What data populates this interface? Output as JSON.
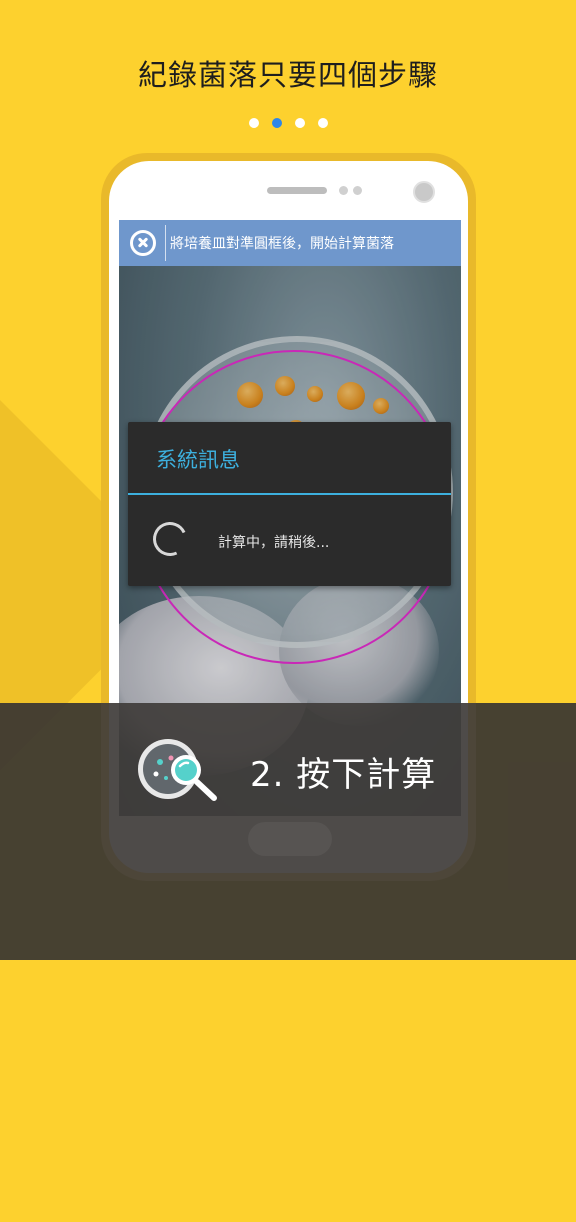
{
  "title": "紀錄菌落只要四個步驟",
  "pager": {
    "count": 4,
    "active_index": 1
  },
  "colors": {
    "background": "#FDD12E",
    "active_dot": "#2E86E8",
    "instruction_bar": "#6F97CC",
    "dialog_accent": "#3DB0DE",
    "target_circle": "#E52ED1",
    "banner": "#373432"
  },
  "app_screen": {
    "instruction_text": "將培養皿對準圓框後，開始計算菌落",
    "close_icon": "close-icon"
  },
  "dialog": {
    "title": "系統訊息",
    "message": "計算中，請稍後..."
  },
  "banner": {
    "icon": "petri-dish-search-icon",
    "text": "2. 按下計算"
  }
}
